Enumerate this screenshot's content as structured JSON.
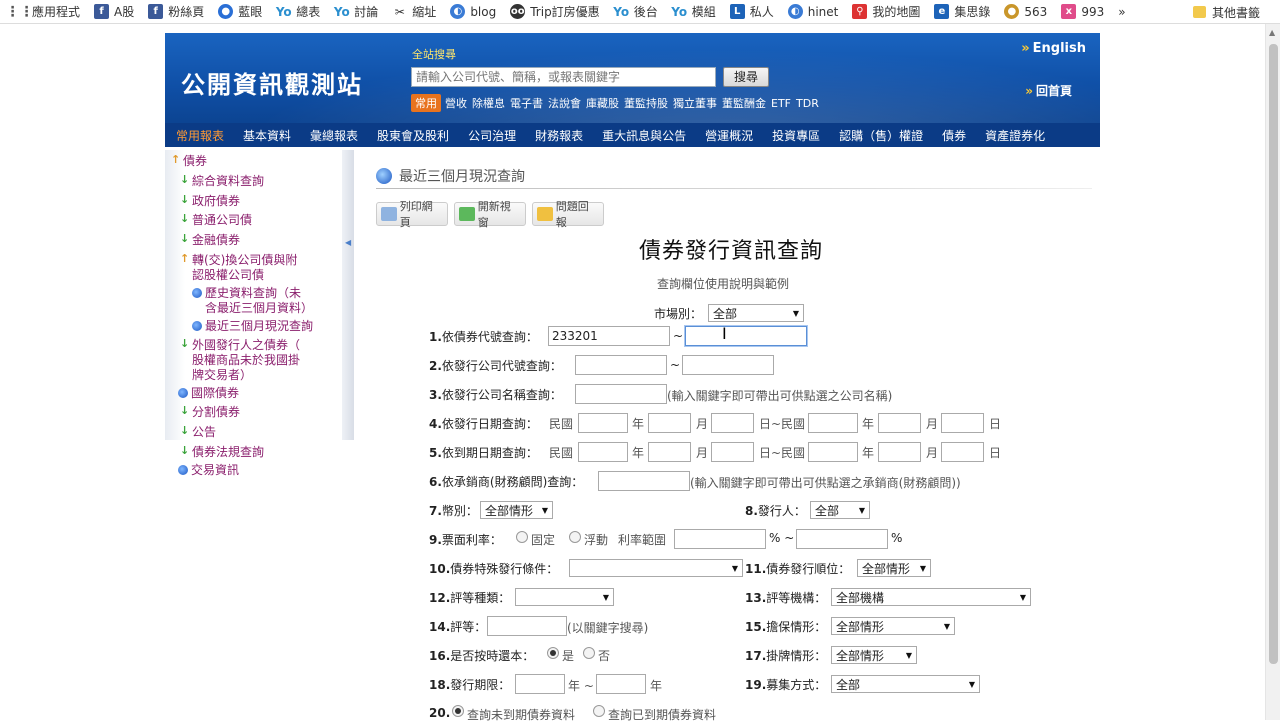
{
  "bookmarks": [
    {
      "label": "應用程式",
      "icon": "apps-icon"
    },
    {
      "label": "A股",
      "icon": "facebook-icon"
    },
    {
      "label": "粉絲頁",
      "icon": "facebook-icon"
    },
    {
      "label": "藍眼",
      "icon": "user-icon"
    },
    {
      "label": "總表",
      "icon": "yo-icon"
    },
    {
      "label": "討論",
      "icon": "yo-icon"
    },
    {
      "label": "縮址",
      "icon": "scissors-icon"
    },
    {
      "label": "blog",
      "icon": "globe-icon"
    },
    {
      "label": "Trip訂房優惠",
      "icon": "tripadvisor-icon"
    },
    {
      "label": "後台",
      "icon": "yo-icon"
    },
    {
      "label": "模組",
      "icon": "yo-icon"
    },
    {
      "label": "私人",
      "icon": "bookmark-icon"
    },
    {
      "label": "hinet",
      "icon": "globe-icon"
    },
    {
      "label": "我的地圖",
      "icon": "map-pin-icon"
    },
    {
      "label": "集思錄",
      "icon": "circle-logo-icon"
    },
    {
      "label": "563",
      "icon": "coin-icon"
    },
    {
      "label": "993",
      "icon": "badge-icon"
    }
  ],
  "bookmarks_more": "»",
  "other_bookmarks": "其他書籤",
  "header": {
    "logo": "公開資訊觀測站",
    "search_label": "全站搜尋",
    "search_placeholder": "請輸入公司代號、簡稱，或報表關鍵字",
    "search_button": "搜尋",
    "quick_tag": "常用",
    "quick_links": [
      "營收",
      "除權息",
      "電子書",
      "法說會",
      "庫藏股",
      "董監持股",
      "獨立董事",
      "董監酬金",
      "ETF",
      "TDR"
    ],
    "english": "English",
    "home": "回首頁",
    "arrow": "»"
  },
  "nav": [
    "常用報表",
    "基本資料",
    "彙總報表",
    "股東會及股利",
    "公司治理",
    "財務報表",
    "重大訊息與公告",
    "營運概況",
    "投資專區",
    "認購（售）權證",
    "債券",
    "資產證券化"
  ],
  "nav_active": 0,
  "sidebar": {
    "items": [
      {
        "label": "債券",
        "icon": "up"
      },
      {
        "label": "綜合資料查詢",
        "icon": "down"
      },
      {
        "label": "政府債券",
        "icon": "down"
      },
      {
        "label": "普通公司債",
        "icon": "down"
      },
      {
        "label": "金融債券",
        "icon": "down"
      },
      {
        "label": "轉(交)換公司債與附",
        "label2": "認股權公司債",
        "icon": "up"
      },
      {
        "label": "歷史資料查詢（未",
        "label2": "含最近三個月資料）",
        "icon": "dot"
      },
      {
        "label": "最近三個月現況查詢",
        "icon": "dot"
      },
      {
        "label": "外國發行人之債券（",
        "label2": "股權商品未於我國掛",
        "label3": "牌交易者）",
        "icon": "down"
      },
      {
        "label": "國際債券",
        "icon": "dot"
      },
      {
        "label": "分割債券",
        "icon": "down"
      },
      {
        "label": "公告",
        "icon": "down"
      },
      {
        "label": "債券法規查詢",
        "icon": "down"
      },
      {
        "label": "交易資訊",
        "icon": "dot"
      }
    ]
  },
  "content": {
    "heading": "最近三個月現況查詢",
    "tools": [
      "列印網頁",
      "開新視窗",
      "問題回報"
    ],
    "title": "債券發行資訊查詢",
    "help": "查詢欄位使用說明與範例",
    "market_label": "市場別：",
    "market_value": "全部",
    "q1": {
      "num": "1.",
      "label": "依債券代號查詢：",
      "value_from": "233201",
      "value_to": "",
      "sep": "~"
    },
    "q2": {
      "num": "2.",
      "label": "依發行公司代號查詢：",
      "sep": "~"
    },
    "q3": {
      "num": "3.",
      "label": "依發行公司名稱查詢：",
      "note": "(輸入關鍵字即可帶出可供點選之公司名稱)"
    },
    "q4": {
      "num": "4.",
      "label": "依發行日期查詢：",
      "roc": "民國",
      "year": "年",
      "month": "月",
      "day": "日",
      "range": "日~民國",
      "end_day": "日"
    },
    "q5": {
      "num": "5.",
      "label": "依到期日期查詢：",
      "roc": "民國",
      "year": "年",
      "month": "月",
      "day": "日",
      "range": "日~民國",
      "end_day": "日"
    },
    "q6": {
      "num": "6.",
      "label": "依承銷商(財務顧問)查詢：",
      "note": "(輸入關鍵字即可帶出可供點選之承銷商(財務顧問))"
    },
    "q7": {
      "num": "7.",
      "label": "幣別：",
      "value": "全部情形"
    },
    "q8": {
      "num": "8.",
      "label": "發行人：",
      "value": "全部"
    },
    "q9": {
      "num": "9.",
      "label": "票面利率：",
      "opt_fixed": "固定",
      "opt_float": "浮動",
      "range_label": "利率範圍",
      "pct": "%",
      "pct_sep": "% ~"
    },
    "q10": {
      "num": "10.",
      "label": "債券特殊發行條件：",
      "value": ""
    },
    "q11": {
      "num": "11.",
      "label": "債券發行順位：",
      "value": "全部情形"
    },
    "q12": {
      "num": "12.",
      "label": "評等種類：",
      "value": ""
    },
    "q13": {
      "num": "13.",
      "label": "評等機構：",
      "value": "全部機構"
    },
    "q14": {
      "num": "14.",
      "label": "評等：",
      "note": "(以關鍵字搜尋)"
    },
    "q15": {
      "num": "15.",
      "label": "擔保情形：",
      "value": "全部情形"
    },
    "q16": {
      "num": "16.",
      "label": "是否按時還本：",
      "opt_yes": "是",
      "opt_no": "否"
    },
    "q17": {
      "num": "17.",
      "label": "掛牌情形：",
      "value": "全部情形"
    },
    "q18": {
      "num": "18.",
      "label": "發行期限：",
      "year": "年",
      "sep": "年 ~"
    },
    "q19": {
      "num": "19.",
      "label": "募集方式：",
      "value": "全部"
    },
    "q20": {
      "num": "20.",
      "opt_unexpired": "查詢未到期債券資料",
      "opt_expired": "查詢已到期債券資料"
    }
  }
}
